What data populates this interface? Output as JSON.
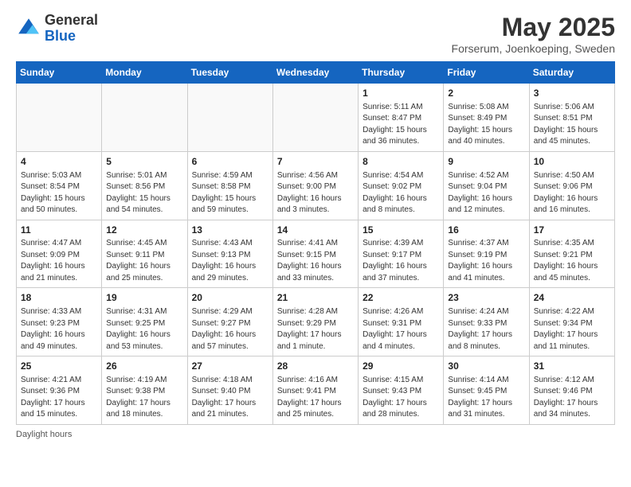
{
  "logo": {
    "general": "General",
    "blue": "Blue"
  },
  "title": "May 2025",
  "subtitle": "Forserum, Joenkoeping, Sweden",
  "weekdays": [
    "Sunday",
    "Monday",
    "Tuesday",
    "Wednesday",
    "Thursday",
    "Friday",
    "Saturday"
  ],
  "weeks": [
    [
      {
        "day": "",
        "info": ""
      },
      {
        "day": "",
        "info": ""
      },
      {
        "day": "",
        "info": ""
      },
      {
        "day": "",
        "info": ""
      },
      {
        "day": "1",
        "info": "Sunrise: 5:11 AM\nSunset: 8:47 PM\nDaylight: 15 hours\nand 36 minutes."
      },
      {
        "day": "2",
        "info": "Sunrise: 5:08 AM\nSunset: 8:49 PM\nDaylight: 15 hours\nand 40 minutes."
      },
      {
        "day": "3",
        "info": "Sunrise: 5:06 AM\nSunset: 8:51 PM\nDaylight: 15 hours\nand 45 minutes."
      }
    ],
    [
      {
        "day": "4",
        "info": "Sunrise: 5:03 AM\nSunset: 8:54 PM\nDaylight: 15 hours\nand 50 minutes."
      },
      {
        "day": "5",
        "info": "Sunrise: 5:01 AM\nSunset: 8:56 PM\nDaylight: 15 hours\nand 54 minutes."
      },
      {
        "day": "6",
        "info": "Sunrise: 4:59 AM\nSunset: 8:58 PM\nDaylight: 15 hours\nand 59 minutes."
      },
      {
        "day": "7",
        "info": "Sunrise: 4:56 AM\nSunset: 9:00 PM\nDaylight: 16 hours\nand 3 minutes."
      },
      {
        "day": "8",
        "info": "Sunrise: 4:54 AM\nSunset: 9:02 PM\nDaylight: 16 hours\nand 8 minutes."
      },
      {
        "day": "9",
        "info": "Sunrise: 4:52 AM\nSunset: 9:04 PM\nDaylight: 16 hours\nand 12 minutes."
      },
      {
        "day": "10",
        "info": "Sunrise: 4:50 AM\nSunset: 9:06 PM\nDaylight: 16 hours\nand 16 minutes."
      }
    ],
    [
      {
        "day": "11",
        "info": "Sunrise: 4:47 AM\nSunset: 9:09 PM\nDaylight: 16 hours\nand 21 minutes."
      },
      {
        "day": "12",
        "info": "Sunrise: 4:45 AM\nSunset: 9:11 PM\nDaylight: 16 hours\nand 25 minutes."
      },
      {
        "day": "13",
        "info": "Sunrise: 4:43 AM\nSunset: 9:13 PM\nDaylight: 16 hours\nand 29 minutes."
      },
      {
        "day": "14",
        "info": "Sunrise: 4:41 AM\nSunset: 9:15 PM\nDaylight: 16 hours\nand 33 minutes."
      },
      {
        "day": "15",
        "info": "Sunrise: 4:39 AM\nSunset: 9:17 PM\nDaylight: 16 hours\nand 37 minutes."
      },
      {
        "day": "16",
        "info": "Sunrise: 4:37 AM\nSunset: 9:19 PM\nDaylight: 16 hours\nand 41 minutes."
      },
      {
        "day": "17",
        "info": "Sunrise: 4:35 AM\nSunset: 9:21 PM\nDaylight: 16 hours\nand 45 minutes."
      }
    ],
    [
      {
        "day": "18",
        "info": "Sunrise: 4:33 AM\nSunset: 9:23 PM\nDaylight: 16 hours\nand 49 minutes."
      },
      {
        "day": "19",
        "info": "Sunrise: 4:31 AM\nSunset: 9:25 PM\nDaylight: 16 hours\nand 53 minutes."
      },
      {
        "day": "20",
        "info": "Sunrise: 4:29 AM\nSunset: 9:27 PM\nDaylight: 16 hours\nand 57 minutes."
      },
      {
        "day": "21",
        "info": "Sunrise: 4:28 AM\nSunset: 9:29 PM\nDaylight: 17 hours\nand 1 minute."
      },
      {
        "day": "22",
        "info": "Sunrise: 4:26 AM\nSunset: 9:31 PM\nDaylight: 17 hours\nand 4 minutes."
      },
      {
        "day": "23",
        "info": "Sunrise: 4:24 AM\nSunset: 9:33 PM\nDaylight: 17 hours\nand 8 minutes."
      },
      {
        "day": "24",
        "info": "Sunrise: 4:22 AM\nSunset: 9:34 PM\nDaylight: 17 hours\nand 11 minutes."
      }
    ],
    [
      {
        "day": "25",
        "info": "Sunrise: 4:21 AM\nSunset: 9:36 PM\nDaylight: 17 hours\nand 15 minutes."
      },
      {
        "day": "26",
        "info": "Sunrise: 4:19 AM\nSunset: 9:38 PM\nDaylight: 17 hours\nand 18 minutes."
      },
      {
        "day": "27",
        "info": "Sunrise: 4:18 AM\nSunset: 9:40 PM\nDaylight: 17 hours\nand 21 minutes."
      },
      {
        "day": "28",
        "info": "Sunrise: 4:16 AM\nSunset: 9:41 PM\nDaylight: 17 hours\nand 25 minutes."
      },
      {
        "day": "29",
        "info": "Sunrise: 4:15 AM\nSunset: 9:43 PM\nDaylight: 17 hours\nand 28 minutes."
      },
      {
        "day": "30",
        "info": "Sunrise: 4:14 AM\nSunset: 9:45 PM\nDaylight: 17 hours\nand 31 minutes."
      },
      {
        "day": "31",
        "info": "Sunrise: 4:12 AM\nSunset: 9:46 PM\nDaylight: 17 hours\nand 34 minutes."
      }
    ]
  ],
  "footer": "Daylight hours"
}
